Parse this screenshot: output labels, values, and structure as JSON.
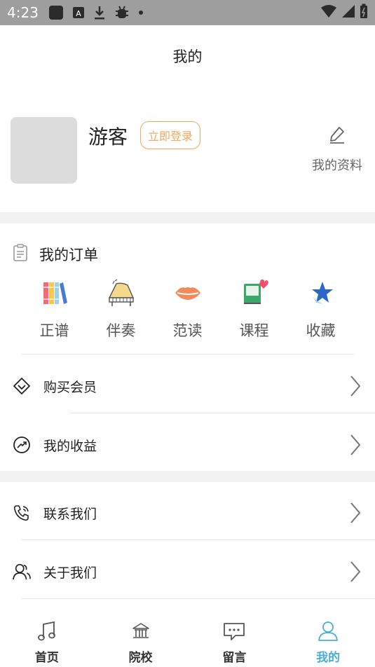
{
  "status_bar": {
    "time": "4:23",
    "icons": [
      "app-icon",
      "a-icon",
      "download-icon",
      "bug-icon",
      "dot-icon"
    ],
    "right_icons": [
      "wifi-icon",
      "signal-icon",
      "battery-icon"
    ]
  },
  "header": {
    "title": "我的"
  },
  "profile": {
    "name": "游客",
    "login_label": "立即登录",
    "edit_label": "我的资料"
  },
  "orders": {
    "title": "我的订单",
    "items": [
      {
        "label": "正谱",
        "icon": "books-icon"
      },
      {
        "label": "伴奏",
        "icon": "piano-icon"
      },
      {
        "label": "范读",
        "icon": "lips-icon"
      },
      {
        "label": "课程",
        "icon": "course-book-icon"
      },
      {
        "label": "收藏",
        "icon": "star-icon"
      }
    ]
  },
  "menu": [
    {
      "label": "购买会员",
      "icon": "diamond-icon"
    },
    {
      "label": "我的收益",
      "icon": "trend-icon"
    },
    {
      "label": "联系我们",
      "icon": "phone-icon"
    },
    {
      "label": "关于我们",
      "icon": "people-icon"
    }
  ],
  "tabbar": {
    "active_color": "#4aaed8",
    "tabs": [
      {
        "label": "首页",
        "icon": "music-note-icon"
      },
      {
        "label": "院校",
        "icon": "school-icon"
      },
      {
        "label": "留言",
        "icon": "message-icon"
      },
      {
        "label": "我的",
        "icon": "user-icon",
        "active": true
      }
    ]
  }
}
